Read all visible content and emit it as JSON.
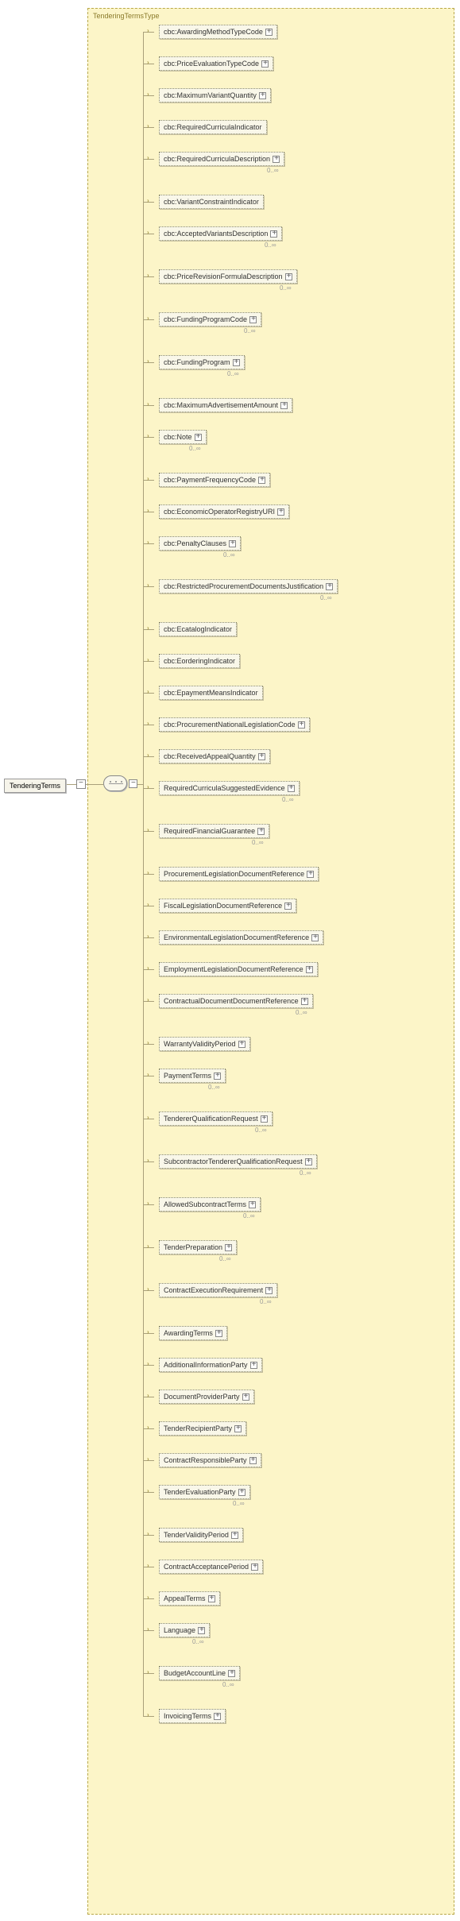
{
  "diagram": {
    "type_label": "TenderingTermsType",
    "root_label": "TenderingTerms",
    "cardinality_unbounded": "0..∞",
    "children": [
      {
        "label": "cbc:AwardingMethodTypeCode",
        "expandable": true,
        "cardinality": null
      },
      {
        "label": "cbc:PriceEvaluationTypeCode",
        "expandable": true,
        "cardinality": null
      },
      {
        "label": "cbc:MaximumVariantQuantity",
        "expandable": true,
        "cardinality": null
      },
      {
        "label": "cbc:RequiredCurriculaIndicator",
        "expandable": false,
        "cardinality": null
      },
      {
        "label": "cbc:RequiredCurriculaDescription",
        "expandable": true,
        "cardinality": "0..∞"
      },
      {
        "label": "cbc:VariantConstraintIndicator",
        "expandable": false,
        "cardinality": null
      },
      {
        "label": "cbc:AcceptedVariantsDescription",
        "expandable": true,
        "cardinality": "0..∞"
      },
      {
        "label": "cbc:PriceRevisionFormulaDescription",
        "expandable": true,
        "cardinality": "0..∞"
      },
      {
        "label": "cbc:FundingProgramCode",
        "expandable": true,
        "cardinality": "0..∞"
      },
      {
        "label": "cbc:FundingProgram",
        "expandable": true,
        "cardinality": "0..∞"
      },
      {
        "label": "cbc:MaximumAdvertisementAmount",
        "expandable": true,
        "cardinality": null
      },
      {
        "label": "cbc:Note",
        "expandable": true,
        "cardinality": "0..∞"
      },
      {
        "label": "cbc:PaymentFrequencyCode",
        "expandable": true,
        "cardinality": null
      },
      {
        "label": "cbc:EconomicOperatorRegistryURI",
        "expandable": true,
        "cardinality": null
      },
      {
        "label": "cbc:PenaltyClauses",
        "expandable": true,
        "cardinality": "0..∞"
      },
      {
        "label": "cbc:RestrictedProcurementDocumentsJustification",
        "expandable": true,
        "cardinality": "0..∞"
      },
      {
        "label": "cbc:EcatalogIndicator",
        "expandable": false,
        "cardinality": null
      },
      {
        "label": "cbc:EorderingIndicator",
        "expandable": false,
        "cardinality": null
      },
      {
        "label": "cbc:EpaymentMeansIndicator",
        "expandable": false,
        "cardinality": null
      },
      {
        "label": "cbc:ProcurementNationalLegislationCode",
        "expandable": true,
        "cardinality": null
      },
      {
        "label": "cbc:ReceivedAppealQuantity",
        "expandable": true,
        "cardinality": null
      },
      {
        "label": "RequiredCurriculaSuggestedEvidence",
        "expandable": true,
        "cardinality": "0..∞"
      },
      {
        "label": "RequiredFinancialGuarantee",
        "expandable": true,
        "cardinality": "0..∞"
      },
      {
        "label": "ProcurementLegislationDocumentReference",
        "expandable": true,
        "cardinality": null
      },
      {
        "label": "FiscalLegislationDocumentReference",
        "expandable": true,
        "cardinality": null
      },
      {
        "label": "EnvironmentalLegislationDocumentReference",
        "expandable": true,
        "cardinality": null
      },
      {
        "label": "EmploymentLegislationDocumentReference",
        "expandable": true,
        "cardinality": null
      },
      {
        "label": "ContractualDocumentDocumentReference",
        "expandable": true,
        "cardinality": "0..∞"
      },
      {
        "label": "WarrantyValidityPeriod",
        "expandable": true,
        "cardinality": null
      },
      {
        "label": "PaymentTerms",
        "expandable": true,
        "cardinality": "0..∞"
      },
      {
        "label": "TendererQualificationRequest",
        "expandable": true,
        "cardinality": "0..∞"
      },
      {
        "label": "SubcontractorTendererQualificationRequest",
        "expandable": true,
        "cardinality": "0..∞"
      },
      {
        "label": "AllowedSubcontractTerms",
        "expandable": true,
        "cardinality": "0..∞"
      },
      {
        "label": "TenderPreparation",
        "expandable": true,
        "cardinality": "0..∞"
      },
      {
        "label": "ContractExecutionRequirement",
        "expandable": true,
        "cardinality": "0..∞"
      },
      {
        "label": "AwardingTerms",
        "expandable": true,
        "cardinality": null
      },
      {
        "label": "AdditionalInformationParty",
        "expandable": true,
        "cardinality": null
      },
      {
        "label": "DocumentProviderParty",
        "expandable": true,
        "cardinality": null
      },
      {
        "label": "TenderRecipientParty",
        "expandable": true,
        "cardinality": null
      },
      {
        "label": "ContractResponsibleParty",
        "expandable": true,
        "cardinality": null
      },
      {
        "label": "TenderEvaluationParty",
        "expandable": true,
        "cardinality": "0..∞"
      },
      {
        "label": "TenderValidityPeriod",
        "expandable": true,
        "cardinality": null
      },
      {
        "label": "ContractAcceptancePeriod",
        "expandable": true,
        "cardinality": null
      },
      {
        "label": "AppealTerms",
        "expandable": true,
        "cardinality": null
      },
      {
        "label": "Language",
        "expandable": true,
        "cardinality": "0..∞"
      },
      {
        "label": "BudgetAccountLine",
        "expandable": true,
        "cardinality": "0..∞"
      },
      {
        "label": "InvoicingTerms",
        "expandable": true,
        "cardinality": null
      }
    ]
  }
}
